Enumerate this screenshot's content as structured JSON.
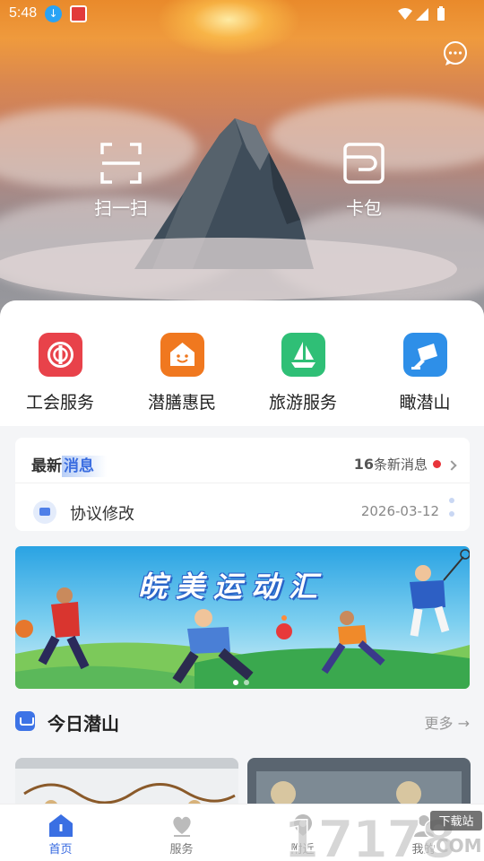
{
  "status_bar": {
    "time": "5:48"
  },
  "hero": {
    "actions": [
      {
        "label": "扫一扫",
        "icon": "scan-icon"
      },
      {
        "label": "卡包",
        "icon": "wallet-icon"
      }
    ],
    "message_icon": "chat-bubble-icon"
  },
  "services": [
    {
      "label": "工会服务",
      "icon": "union-icon",
      "color": "#e8424a"
    },
    {
      "label": "潜膳惠民",
      "icon": "house-smile-icon",
      "color": "#f0781f"
    },
    {
      "label": "旅游服务",
      "icon": "sailboat-icon",
      "color": "#2fbf76"
    },
    {
      "label": "瞰潜山",
      "icon": "camera-icon",
      "color": "#2e8fe8"
    }
  ],
  "news": {
    "title_prefix": "最新",
    "title_highlight": "消息",
    "count_number": "16",
    "count_text": "条新消息",
    "item": {
      "title": "协议修改",
      "date": "2026-03-12"
    }
  },
  "banner": {
    "title": "皖美运动汇"
  },
  "today": {
    "title": "今日潜山",
    "more": "更多"
  },
  "tabs": [
    {
      "label": "首页",
      "icon": "home-icon",
      "active": true
    },
    {
      "label": "服务",
      "icon": "service-icon",
      "active": false
    },
    {
      "label": "附近",
      "icon": "nearby-icon",
      "active": false
    },
    {
      "label": "我的",
      "icon": "profile-icon",
      "active": false
    }
  ],
  "colors": {
    "accent": "#3568e0",
    "red_dot": "#e8343a"
  }
}
